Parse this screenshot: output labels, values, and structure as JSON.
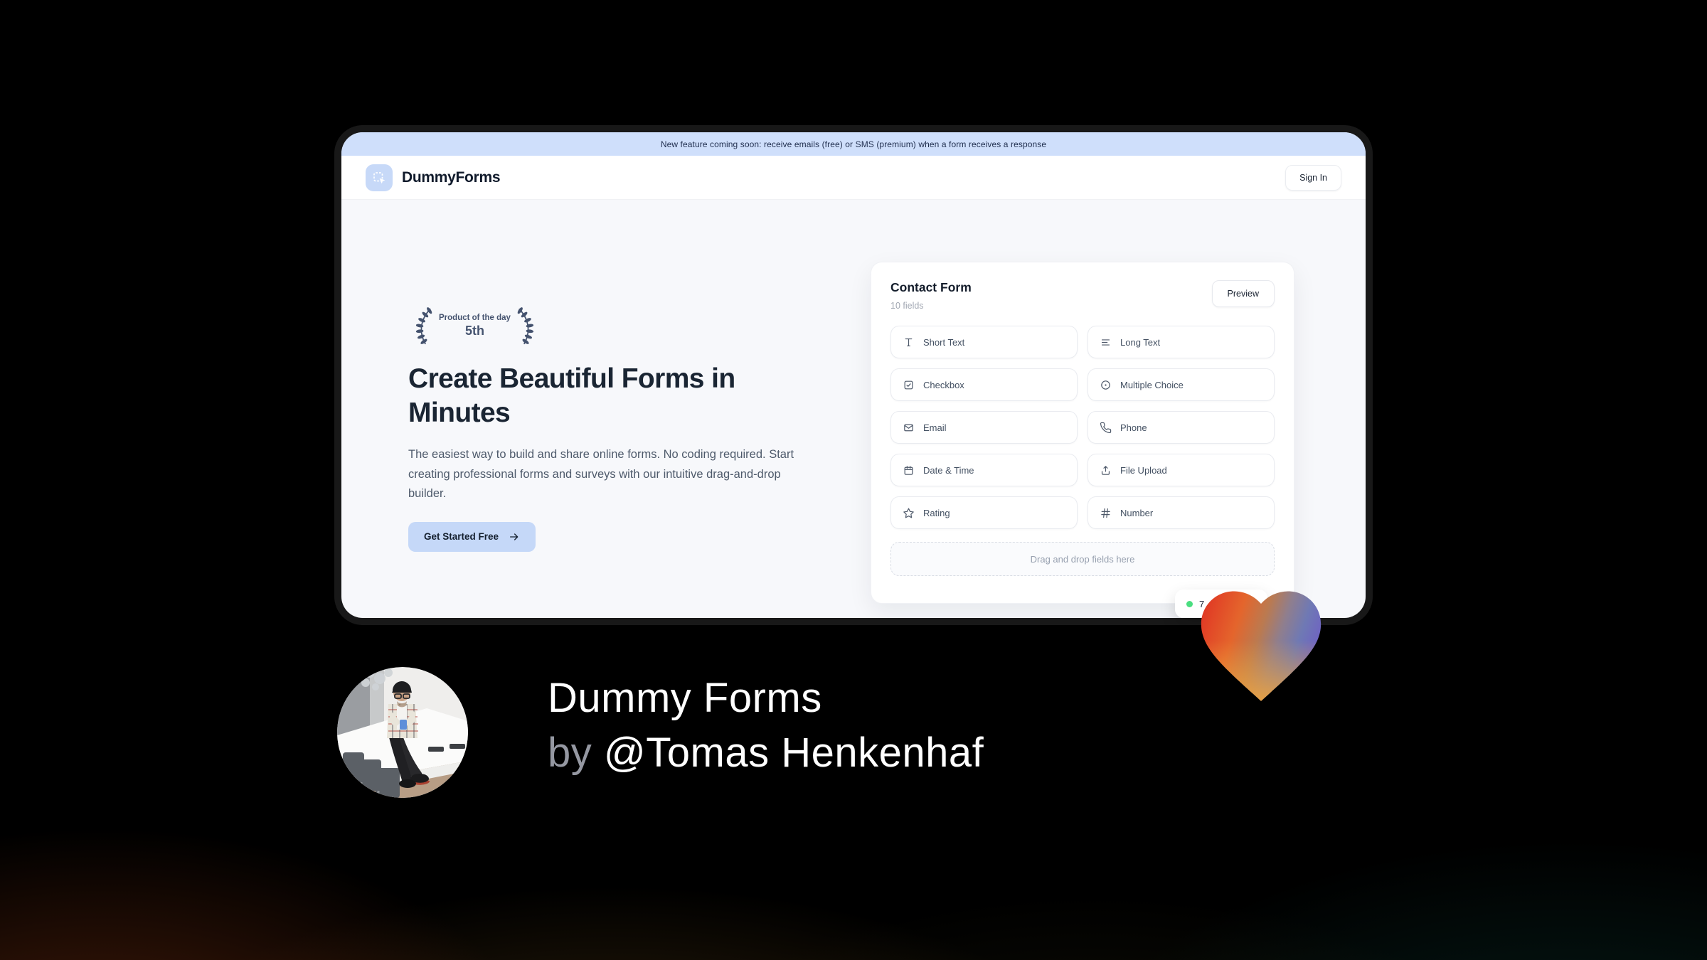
{
  "banner": {
    "text": "New feature coming soon: receive emails (free) or SMS (premium) when a form receives a response"
  },
  "header": {
    "brand": "DummyForms",
    "sign_in_label": "Sign In"
  },
  "hero": {
    "award_line1": "Product of the day",
    "award_rank": "5th",
    "title": "Create Beautiful Forms in Minutes",
    "description": "The easiest way to build and share online forms. No coding required. Start creating professional forms and surveys with our intuitive drag-and-drop builder.",
    "cta_label": "Get Started Free"
  },
  "builder": {
    "title": "Contact Form",
    "field_count_label": "10 fields",
    "preview_label": "Preview",
    "fields": [
      {
        "icon": "short-text-icon",
        "label": "Short Text"
      },
      {
        "icon": "long-text-icon",
        "label": "Long Text"
      },
      {
        "icon": "checkbox-icon",
        "label": "Checkbox"
      },
      {
        "icon": "multiple-choice-icon",
        "label": "Multiple Choice"
      },
      {
        "icon": "email-icon",
        "label": "Email"
      },
      {
        "icon": "phone-icon",
        "label": "Phone"
      },
      {
        "icon": "date-time-icon",
        "label": "Date & Time"
      },
      {
        "icon": "file-upload-icon",
        "label": "File Upload"
      },
      {
        "icon": "rating-icon",
        "label": "Rating"
      },
      {
        "icon": "number-icon",
        "label": "Number"
      }
    ],
    "dropzone_label": "Drag and drop fields here",
    "status_badge": {
      "text": "7",
      "dot_color": "#4ade80"
    }
  },
  "caption": {
    "title": "Dummy Forms",
    "byline_prefix": "by ",
    "author": "@Tomas Henkenhaf"
  },
  "colors": {
    "banner_bg": "#cfdffb",
    "accent_blue": "#c5d8f8",
    "page_bg": "#f7f8fb",
    "status_green": "#4ade80",
    "heart_gradient": [
      "#e03524",
      "#e4652c",
      "#f0a43c",
      "#6f79b4",
      "#6f63c2"
    ]
  }
}
